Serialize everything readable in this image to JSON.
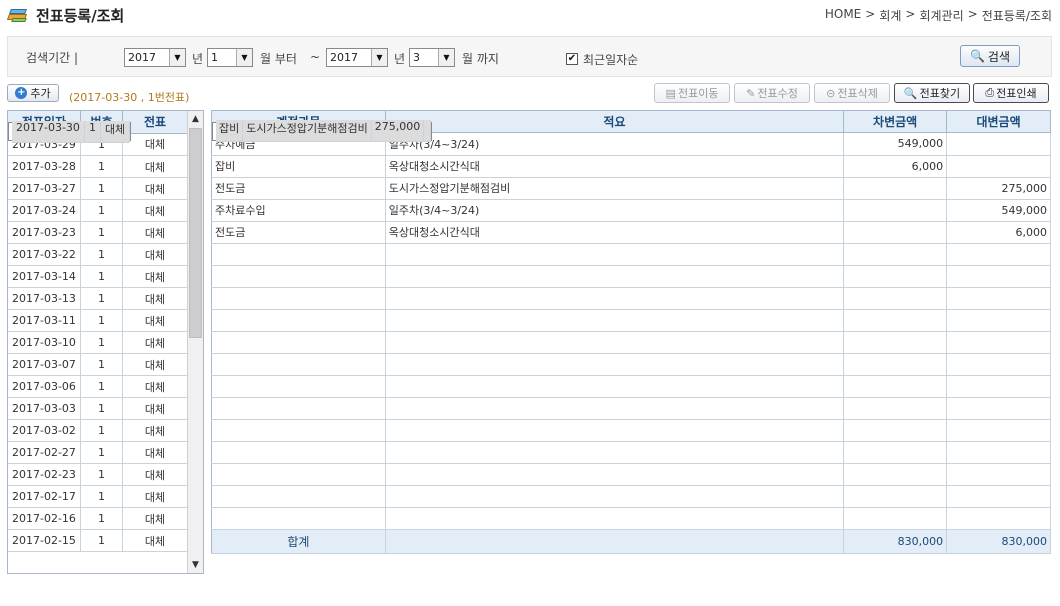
{
  "header": {
    "title": "전표등록/조회",
    "breadcrumb": [
      "HOME",
      ">",
      "회계",
      ">",
      "회계관리",
      ">",
      "전표등록/조회"
    ]
  },
  "search": {
    "period_label": "검색기간 |",
    "from_year": "2017",
    "year_unit": "년",
    "from_month": "1",
    "month_from_unit": "월 부터",
    "tilde": "~",
    "to_year": "2017",
    "to_year_unit": "년",
    "to_month": "3",
    "month_to_unit": "월 까지",
    "recent_checkbox_label": "최근일자순",
    "recent_checked": "✔",
    "search_button": "검색"
  },
  "toolbar": {
    "add_button": "추가",
    "voucher_info": "(2017-03-30 , 1번전표)",
    "move_button": "전표이동",
    "edit_button": "전표수정",
    "delete_button": "전표삭제",
    "find_button": "전표찾기",
    "print_button": "전표인쇄"
  },
  "voucher_list": {
    "columns": [
      "전표일자",
      "번호",
      "전표"
    ],
    "rows": [
      {
        "date": "2017-03-30",
        "no": "1",
        "type": "대체"
      },
      {
        "date": "2017-03-29",
        "no": "1",
        "type": "대체"
      },
      {
        "date": "2017-03-28",
        "no": "1",
        "type": "대체"
      },
      {
        "date": "2017-03-27",
        "no": "1",
        "type": "대체"
      },
      {
        "date": "2017-03-24",
        "no": "1",
        "type": "대체"
      },
      {
        "date": "2017-03-23",
        "no": "1",
        "type": "대체"
      },
      {
        "date": "2017-03-22",
        "no": "1",
        "type": "대체"
      },
      {
        "date": "2017-03-14",
        "no": "1",
        "type": "대체"
      },
      {
        "date": "2017-03-13",
        "no": "1",
        "type": "대체"
      },
      {
        "date": "2017-03-11",
        "no": "1",
        "type": "대체"
      },
      {
        "date": "2017-03-10",
        "no": "1",
        "type": "대체"
      },
      {
        "date": "2017-03-07",
        "no": "1",
        "type": "대체"
      },
      {
        "date": "2017-03-06",
        "no": "1",
        "type": "대체"
      },
      {
        "date": "2017-03-03",
        "no": "1",
        "type": "대체"
      },
      {
        "date": "2017-03-02",
        "no": "1",
        "type": "대체"
      },
      {
        "date": "2017-02-27",
        "no": "1",
        "type": "대체"
      },
      {
        "date": "2017-02-23",
        "no": "1",
        "type": "대체"
      },
      {
        "date": "2017-02-17",
        "no": "1",
        "type": "대체"
      },
      {
        "date": "2017-02-16",
        "no": "1",
        "type": "대체"
      },
      {
        "date": "2017-02-15",
        "no": "1",
        "type": "대체"
      }
    ],
    "selected_index": 0
  },
  "entries": {
    "columns": [
      "계정과목",
      "적요",
      "차변금액",
      "대변금액"
    ],
    "rows": [
      {
        "account": "잡비",
        "memo": "도시가스정압기분해점검비",
        "debit": "275,000",
        "credit": ""
      },
      {
        "account": "주차예금",
        "memo": "일주차(3/4~3/24)",
        "debit": "549,000",
        "credit": ""
      },
      {
        "account": "잡비",
        "memo": "옥상대청소시간식대",
        "debit": "6,000",
        "credit": ""
      },
      {
        "account": "전도금",
        "memo": "도시가스정압기분해점검비",
        "debit": "",
        "credit": "275,000"
      },
      {
        "account": "주차료수입",
        "memo": "일주차(3/4~3/24)",
        "debit": "",
        "credit": "549,000"
      },
      {
        "account": "전도금",
        "memo": "옥상대청소시간식대",
        "debit": "",
        "credit": "6,000"
      }
    ],
    "empty_rows": 13,
    "total_label": "합계",
    "total_debit": "830,000",
    "total_credit": "830,000"
  }
}
